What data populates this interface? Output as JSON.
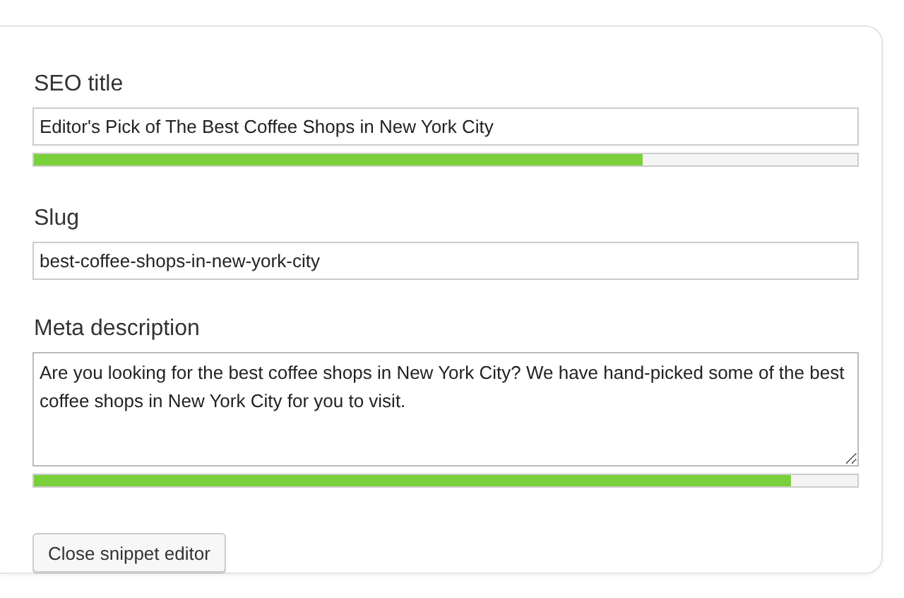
{
  "fields": [
    {
      "kind": "input",
      "label": "SEO title",
      "value": "Editor's Pick of The Best Coffee Shops in New York City",
      "level": 0.74
    },
    {
      "kind": "input",
      "label": "Slug",
      "value": "best-coffee-shops-in-new-york-city"
    },
    {
      "kind": "textarea",
      "label": "Meta description",
      "value": "Are you looking for the best coffee shops in New York City? We have hand-picked some of the best coffee shops in New York City for you to visit.",
      "level": 0.92
    }
  ],
  "button": "Close snippet editor"
}
